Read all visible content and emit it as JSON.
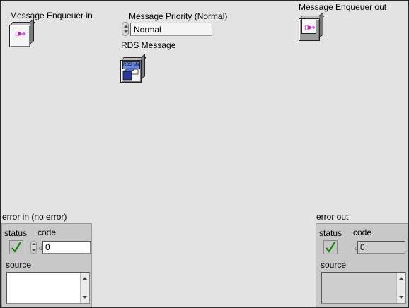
{
  "labels": {
    "enqueuer_in": "Message Enqueuer in",
    "priority": "Message Priority (Normal)",
    "enqueuer_out": "Message Enqueuer out",
    "rds_message": "RDS Message"
  },
  "priority_ring": {
    "value": "Normal"
  },
  "rds_icon": {
    "text": "RDS Msg"
  },
  "error_in": {
    "title": "error in (no error)",
    "status_label": "status",
    "code_label": "code",
    "code_value": "0",
    "radix": "d",
    "source_label": "source",
    "source_value": ""
  },
  "error_out": {
    "title": "error out",
    "status_label": "status",
    "code_label": "code",
    "code_value": "0",
    "radix": "d",
    "source_label": "source",
    "source_value": ""
  },
  "colors": {
    "panel_bg": "#e3e3e3",
    "check_green": "#2fa020",
    "class_magenta": "#c020c0",
    "rds_blue": "#2a3a9a"
  }
}
